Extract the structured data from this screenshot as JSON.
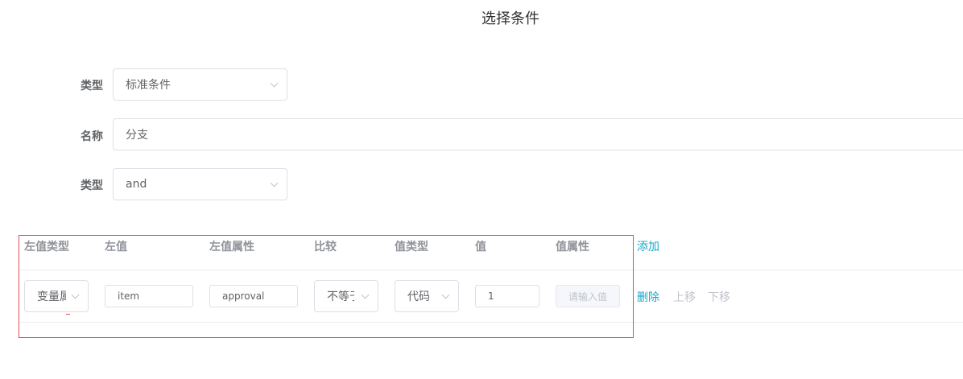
{
  "dialog": {
    "title": "选择条件"
  },
  "form": {
    "type_label": "类型",
    "type_value": "标准条件",
    "name_label": "名称",
    "name_value": "分支",
    "logic_label": "类型",
    "logic_value": "and"
  },
  "conditions": {
    "headers": {
      "left_type": "左值类型",
      "left_value": "左值",
      "left_attr": "左值属性",
      "compare": "比较",
      "value_type": "值类型",
      "value": "值",
      "value_attr": "值属性"
    },
    "add_label": "添加",
    "rows": [
      {
        "left_type": "变量属",
        "left_value": "item",
        "left_attr": "approval",
        "compare": "不等于",
        "value_type": "代码",
        "value": "1",
        "value_attr_placeholder": "请输入值",
        "delete_label": "删除",
        "up_label": "上移",
        "down_label": "下移"
      }
    ]
  }
}
